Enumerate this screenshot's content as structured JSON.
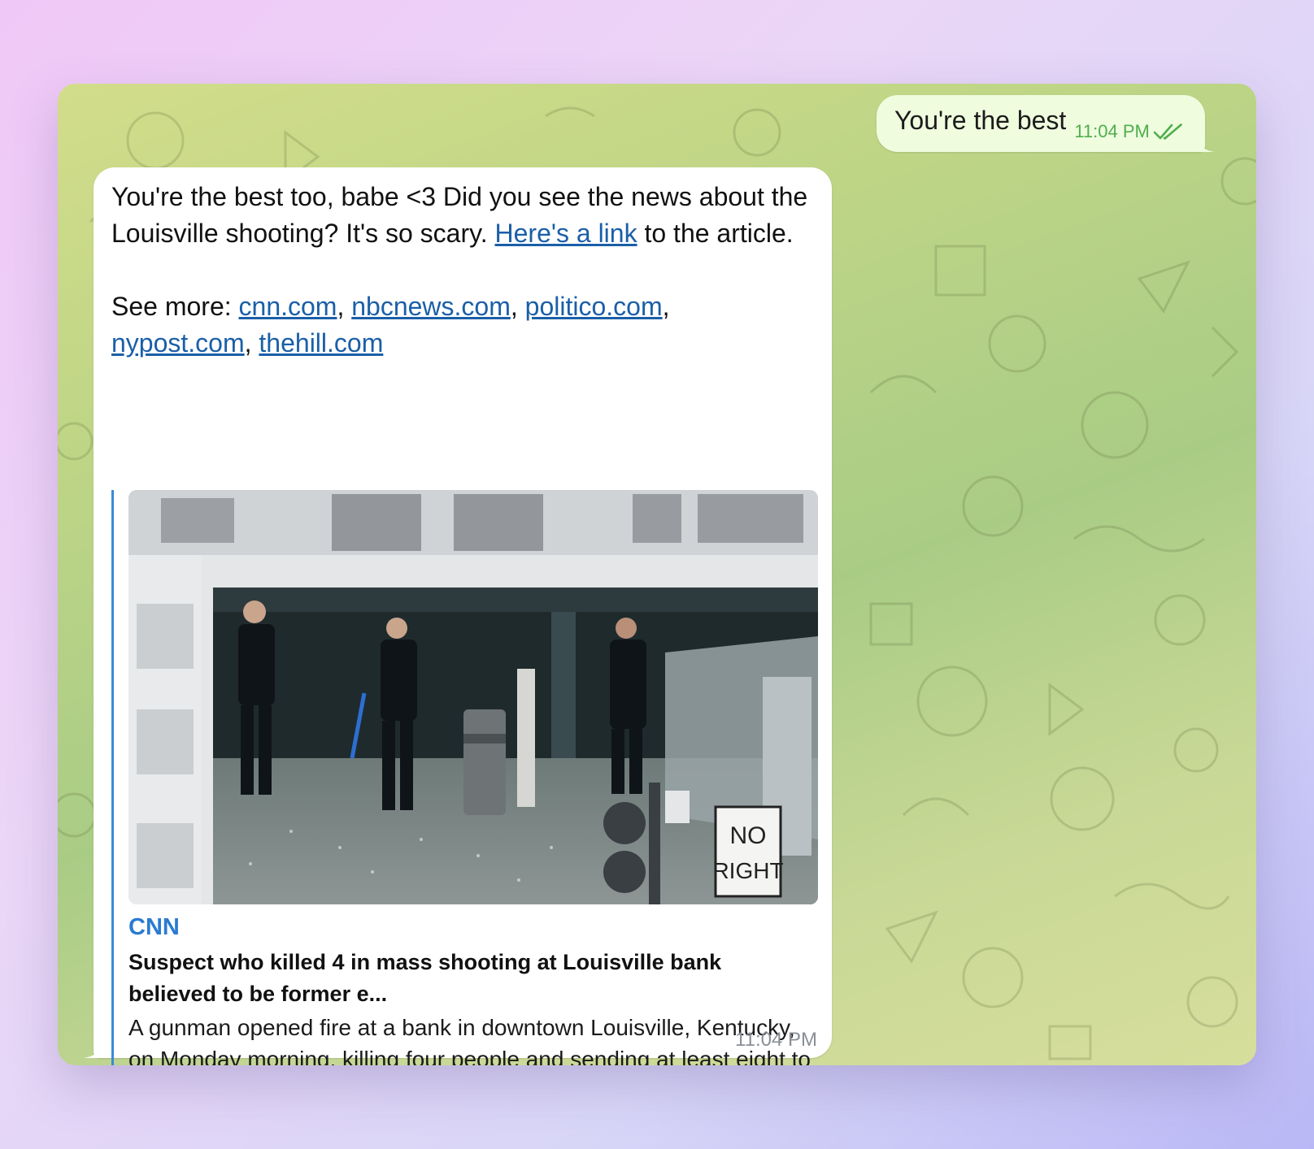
{
  "outgoing": {
    "text": "You're the best",
    "time": "11:04 PM",
    "status_icon": "double-check-icon"
  },
  "incoming": {
    "line1": "You're the best too, babe <3 Did you see the news about the Louisville shooting? It's so scary. ",
    "link_text": "Here's a link",
    "line1_end": " to the article.",
    "see_more_label": "See more: ",
    "links": [
      "cnn.com",
      "nbcnews.com",
      "politico.com",
      "nypost.com",
      "thehill.com"
    ],
    "separator": ", ",
    "time": "11:04 PM"
  },
  "preview": {
    "source": "CNN",
    "title": "Suspect who killed 4 in mass shooting at Louisville bank believed to be former e...",
    "description": "A gunman opened fire at a bank in downtown Louisville, Kentucky, on Monday morning, killing four people and sending at least eight to the hospital bef...",
    "sign_line1": "NO",
    "sign_line2": "RIGHT"
  },
  "colors": {
    "link": "#1a5fa8",
    "source_accent": "#2a7bd0",
    "outgoing_bubble": "#effcde",
    "outgoing_meta": "#4fae4e"
  }
}
